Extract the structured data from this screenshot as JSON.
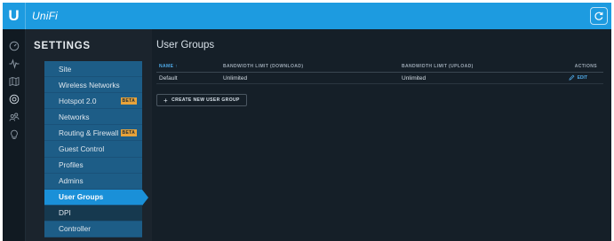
{
  "app": {
    "logo_glyph": "U",
    "brand": "UniFi",
    "accent_color": "#1d9be0",
    "refresh_icon": "refresh-icon"
  },
  "rail": {
    "icons": [
      "dashboard-icon",
      "statistics-icon",
      "map-icon",
      "devices-icon",
      "clients-icon",
      "insights-icon"
    ]
  },
  "settings": {
    "title": "SETTINGS",
    "items": [
      {
        "label": "Site"
      },
      {
        "label": "Wireless Networks"
      },
      {
        "label": "Hotspot 2.0",
        "badge": "BETA"
      },
      {
        "label": "Networks"
      },
      {
        "label": "Routing & Firewall",
        "badge": "BETA"
      },
      {
        "label": "Guest Control"
      },
      {
        "label": "Profiles"
      },
      {
        "label": "Admins"
      },
      {
        "label": "User Groups",
        "active": true
      },
      {
        "label": "DPI"
      },
      {
        "label": "Controller"
      }
    ]
  },
  "main": {
    "title": "User Groups",
    "table": {
      "headers": {
        "name": "NAME",
        "sort_glyph": "↑",
        "download": "BANDWIDTH LIMIT (DOWNLOAD)",
        "upload": "BANDWIDTH LIMIT (UPLOAD)",
        "actions": "ACTIONS"
      },
      "rows": [
        {
          "name": "Default",
          "download": "Unlimited",
          "upload": "Unlimited",
          "action": "EDIT"
        }
      ]
    },
    "create_button": "CREATE NEW USER GROUP"
  }
}
